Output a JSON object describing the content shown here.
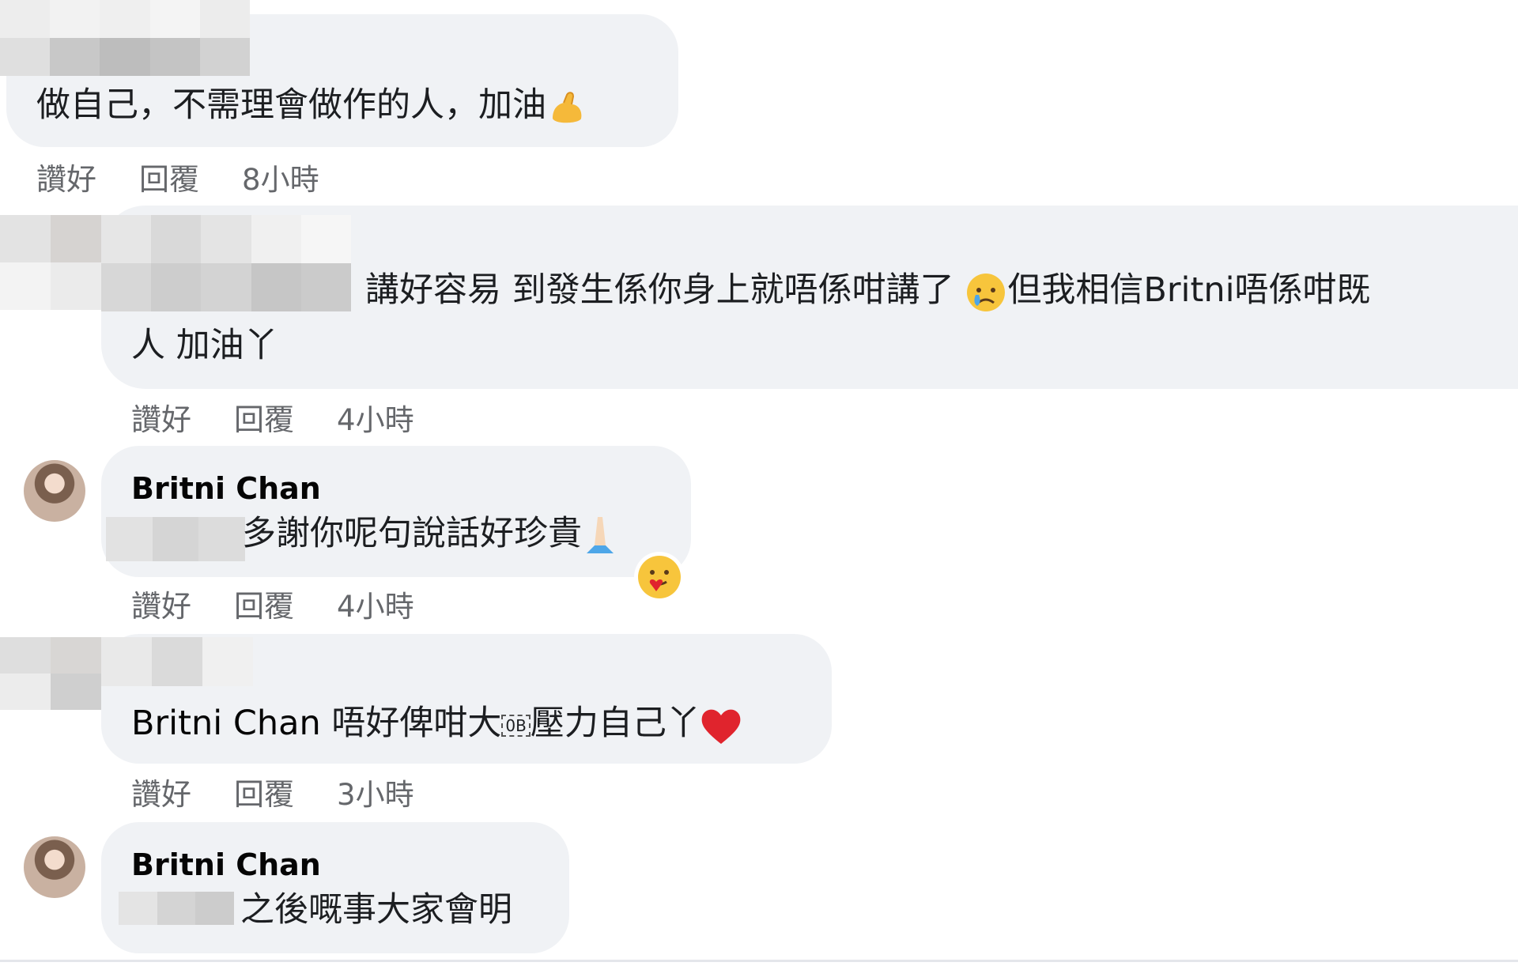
{
  "comments": [
    {
      "text": "做自己，不需理會做作的人，加油",
      "emoji": "flexed-biceps",
      "actions": {
        "like": "讚好",
        "reply": "回覆",
        "time": "8小時"
      }
    },
    {
      "text_line1": "講好容易 到發生係你身上就唔係咁講了",
      "text_line1b": "但我相信Britni唔係咁既",
      "text_line2": "人 加油丫",
      "emoji": "crying-face",
      "actions": {
        "like": "讚好",
        "reply": "回覆",
        "time": "4小時"
      }
    },
    {
      "author": "Britni Chan",
      "text": "多謝你呢句說話好珍貴",
      "emoji": "folded-hands",
      "reaction": "care-reaction",
      "actions": {
        "like": "讚好",
        "reply": "回覆",
        "time": "4小時"
      }
    },
    {
      "mention": "Britni Chan",
      "text": "唔好俾咁大",
      "text_b": "壓力自己丫",
      "special_glyph": "0B",
      "emoji": "red-heart",
      "actions": {
        "like": "讚好",
        "reply": "回覆",
        "time": "3小時"
      }
    },
    {
      "author": "Britni Chan",
      "text": "之後嘅事大家會明"
    }
  ],
  "colors": {
    "bubble": "#f0f2f5",
    "secondary_text": "#65676b",
    "heart": "#e0242d"
  }
}
